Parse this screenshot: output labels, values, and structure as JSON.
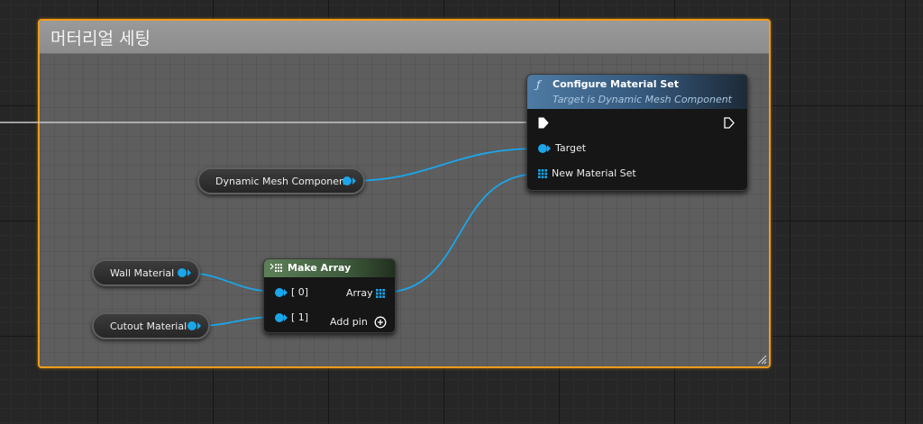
{
  "comment": {
    "title": "머터리얼 세팅",
    "border_color": "#f29b1a"
  },
  "nodes": {
    "configure_material_set": {
      "title": "Configure Material Set",
      "subtitle": "Target is Dynamic Mesh Component",
      "icon": "function-icon",
      "pins": {
        "target": "Target",
        "new_material_set": "New Material Set"
      }
    },
    "make_array": {
      "title": "Make Array",
      "icon": "make-array-icon",
      "pins": {
        "in_0": "[ 0]",
        "in_1": "[ 1]",
        "out": "Array",
        "add_pin": "Add pin"
      }
    },
    "dynamic_mesh_component": {
      "label": "Dynamic Mesh Component"
    },
    "wall_material": {
      "label": "Wall Material"
    },
    "cutout_material": {
      "label": "Cutout Material"
    }
  },
  "colors": {
    "object_pin": "#1ba6ea",
    "exec_pin": "#ffffff",
    "function_header": "#4e7aa3",
    "make_array_header": "#5c7f57"
  }
}
